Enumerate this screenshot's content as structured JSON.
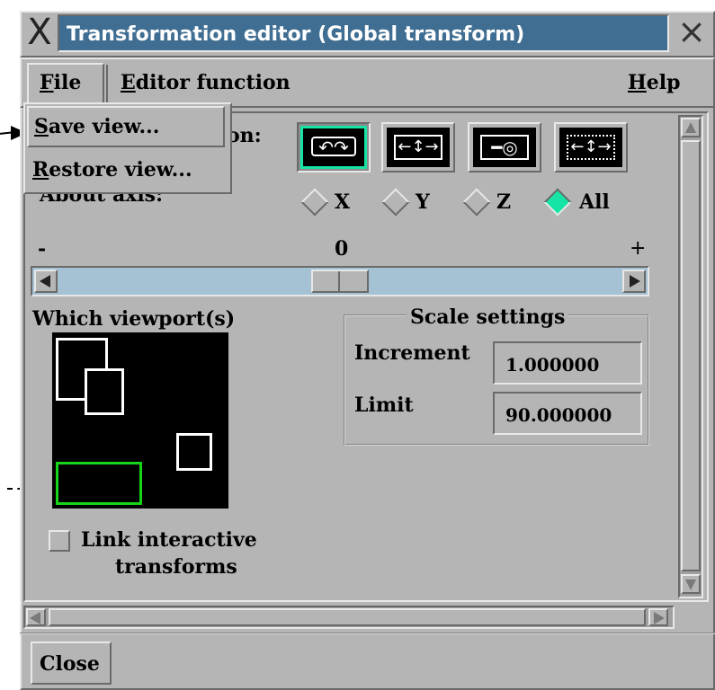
{
  "window": {
    "title": "Transformation editor (Global transform)",
    "close_glyph": "×",
    "logo_glyph": "X"
  },
  "menubar": {
    "file": "File",
    "editor_function": "Editor function",
    "help": "Help"
  },
  "file_menu": {
    "items": [
      "Save view...",
      "Restore view..."
    ]
  },
  "transform": {
    "label_partial": "on:",
    "about_axis_label": "About axis:",
    "buttons": [
      {
        "name": "rotate",
        "selected": true
      },
      {
        "name": "translate",
        "selected": false
      },
      {
        "name": "zoom",
        "selected": false
      },
      {
        "name": "scale",
        "selected": false
      }
    ],
    "axes": [
      {
        "label": "X",
        "selected": false
      },
      {
        "label": "Y",
        "selected": false
      },
      {
        "label": "Z",
        "selected": false
      },
      {
        "label": "All",
        "selected": true
      }
    ],
    "selected_color": "#16e4a7"
  },
  "slider": {
    "min_label": "-",
    "mid_label": "0",
    "max_label": "+",
    "position": 0.5
  },
  "viewports": {
    "label": "Which viewport(s)",
    "active_color": "#18d418"
  },
  "scale_settings": {
    "title": "Scale settings",
    "increment_label": "Increment",
    "increment_value": "1.000000",
    "limit_label": "Limit",
    "limit_value": "90.000000"
  },
  "link": {
    "label_line1": "Link interactive",
    "label_line2": "transforms",
    "checked": false
  },
  "footer": {
    "close_label": "Close"
  },
  "colors": {
    "panel": "#b5b5b5",
    "title_bar": "#3f6e92",
    "slider_trough": "#a4c2d4"
  }
}
